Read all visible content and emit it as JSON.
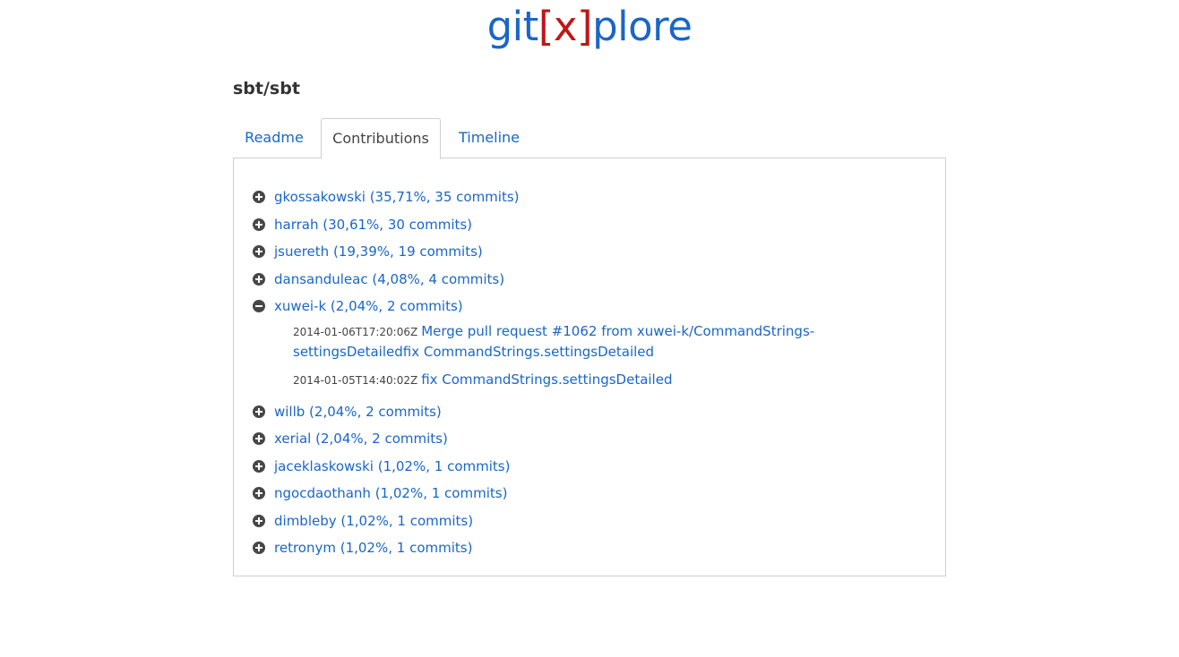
{
  "logo": {
    "part1": "git",
    "part2": "[x]",
    "part3": "plore"
  },
  "repo": {
    "title": "sbt/sbt"
  },
  "tabs": [
    {
      "label": "Readme"
    },
    {
      "label": "Contributions"
    },
    {
      "label": "Timeline"
    }
  ],
  "active_tab": "Contributions",
  "contributors": [
    {
      "label": "gkossakowski (35,71%, 35 commits)",
      "expanded": false
    },
    {
      "label": "harrah (30,61%, 30 commits)",
      "expanded": false
    },
    {
      "label": "jsuereth (19,39%, 19 commits)",
      "expanded": false
    },
    {
      "label": "dansanduleac (4,08%, 4 commits)",
      "expanded": false
    },
    {
      "label": "xuwei-k (2,04%, 2 commits)",
      "expanded": true,
      "commits": [
        {
          "timestamp": "2014-01-06T17:20:06Z",
          "message": "Merge pull request #1062 from xuwei-k/CommandStrings-settingsDetailedfix CommandStrings.settingsDetailed"
        },
        {
          "timestamp": "2014-01-05T14:40:02Z",
          "message": "fix CommandStrings.settingsDetailed"
        }
      ]
    },
    {
      "label": "willb (2,04%, 2 commits)",
      "expanded": false
    },
    {
      "label": "xerial (2,04%, 2 commits)",
      "expanded": false
    },
    {
      "label": "jaceklaskowski (1,02%, 1 commits)",
      "expanded": false
    },
    {
      "label": "ngocdaothanh (1,02%, 1 commits)",
      "expanded": false
    },
    {
      "label": "dimbleby (1,02%, 1 commits)",
      "expanded": false
    },
    {
      "label": "retronym (1,02%, 1 commits)",
      "expanded": false
    }
  ],
  "colors": {
    "link": "#1a66c8",
    "logo_accent": "#c01616",
    "icon": "#474747"
  },
  "icons": {
    "collapsed": "plus-circle-icon",
    "expanded": "minus-circle-icon"
  }
}
